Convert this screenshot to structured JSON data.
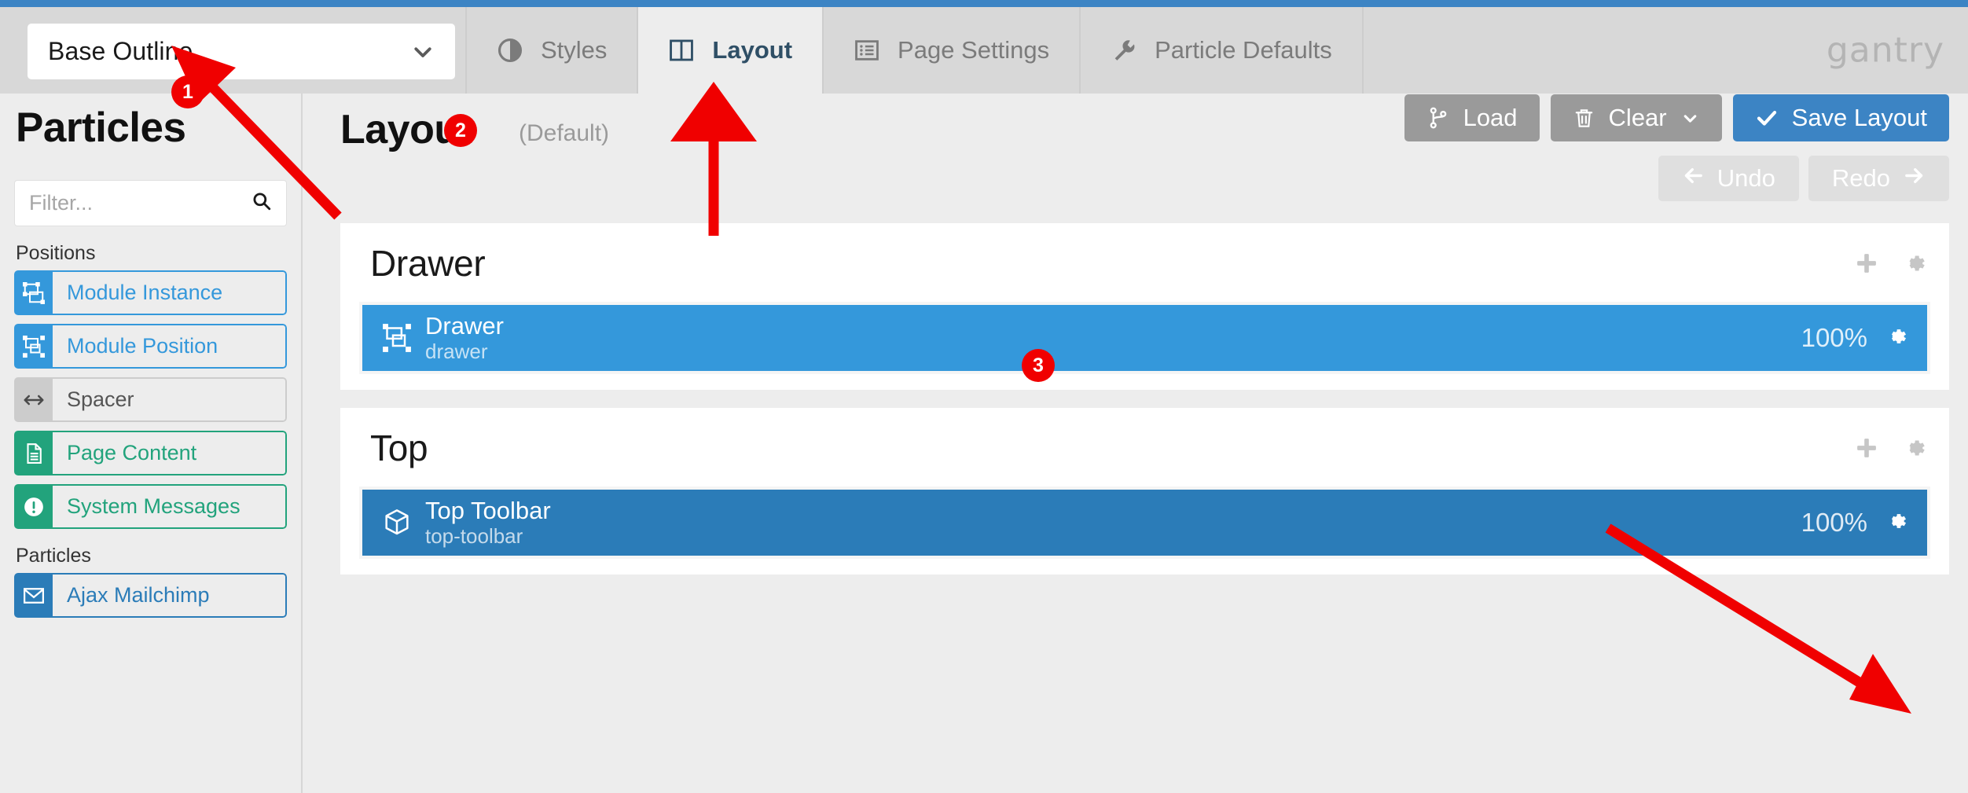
{
  "header": {
    "outline_select": {
      "value": "Base Outline",
      "icon": "chevron-down-icon"
    },
    "tabs": [
      {
        "label": "Styles",
        "icon": "contrast-circle-icon",
        "active": false
      },
      {
        "label": "Layout",
        "icon": "columns-icon",
        "active": true
      },
      {
        "label": "Page Settings",
        "icon": "list-icon",
        "active": false
      },
      {
        "label": "Particle Defaults",
        "icon": "wrench-icon",
        "active": false
      }
    ],
    "brand": "gantry"
  },
  "sidebar": {
    "title": "Particles",
    "filter": {
      "value": "",
      "placeholder": "Filter...",
      "icon": "search-icon"
    },
    "groups": [
      {
        "title": "Positions",
        "items": [
          {
            "label": "Module Instance",
            "color": "blue",
            "icon": "module-instance-icon"
          },
          {
            "label": "Module Position",
            "color": "blue",
            "icon": "module-position-icon"
          },
          {
            "label": "Spacer",
            "color": "gray",
            "icon": "arrows-horizontal-icon"
          },
          {
            "label": "Page Content",
            "color": "green",
            "icon": "document-icon"
          },
          {
            "label": "System Messages",
            "color": "green",
            "icon": "exclamation-circle-icon"
          }
        ]
      },
      {
        "title": "Particles",
        "items": [
          {
            "label": "Ajax Mailchimp",
            "color": "dblue",
            "icon": "envelope-icon"
          }
        ]
      }
    ]
  },
  "main": {
    "title": "Layout",
    "subtitle": "(Default)",
    "buttons": {
      "load": {
        "label": "Load",
        "icon": "branch-icon"
      },
      "clear": {
        "label": "Clear",
        "icon": "trash-icon",
        "caret": "chevron-down-icon"
      },
      "save": {
        "label": "Save Layout",
        "icon": "check-icon"
      }
    },
    "history": {
      "undo": {
        "label": "Undo",
        "icon": "arrow-left-icon"
      },
      "redo": {
        "label": "Redo",
        "icon": "arrow-right-icon"
      }
    },
    "sections": [
      {
        "name": "Drawer",
        "tools": {
          "add": "plus-icon",
          "settings": "gear-icon"
        },
        "blocks": [
          {
            "title": "Drawer",
            "key": "drawer",
            "percent": "100%",
            "shade": "c-light",
            "icon": "module-position-icon",
            "settings_icon": "gear-icon"
          }
        ]
      },
      {
        "name": "Top",
        "tools": {
          "add": "plus-icon",
          "settings": "gear-icon"
        },
        "blocks": [
          {
            "title": "Top Toolbar",
            "key": "top-toolbar",
            "percent": "100%",
            "shade": "c-dark",
            "icon": "cube-icon",
            "settings_icon": "gear-icon"
          }
        ]
      }
    ]
  },
  "annotations": {
    "color": "#f00000",
    "markers": [
      {
        "number": "1",
        "target": "outline-select"
      },
      {
        "number": "2",
        "target": "layout-tab"
      },
      {
        "number": "3",
        "target": "top-toolbar-gear"
      }
    ]
  },
  "colors": {
    "accent_blue": "#3498db",
    "primary_blue": "#3c84c4",
    "dark_blue": "#2b7cb8",
    "green": "#22a37c",
    "gray_button": "#9a9a9a",
    "annotation_red": "#f00000"
  }
}
